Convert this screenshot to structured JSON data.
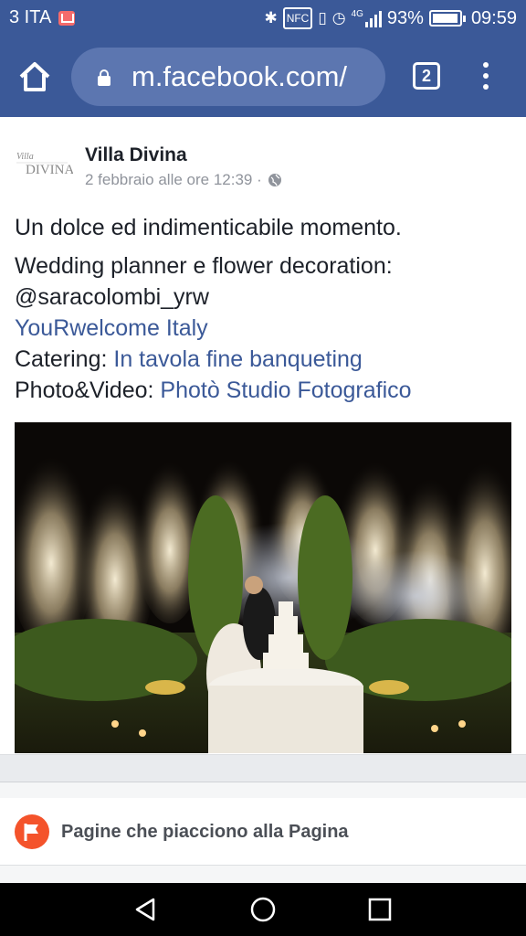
{
  "status_bar": {
    "carrier": "3 ITA",
    "battery_pct": "93%",
    "time": "09:59",
    "network": "4G",
    "battery_level": 0.93,
    "icons": [
      "mail-icon",
      "bluetooth-icon",
      "nfc-icon",
      "vibrate-icon",
      "alarm-icon",
      "signal-icon",
      "battery-icon"
    ]
  },
  "browser": {
    "url": "m.facebook.com/",
    "tab_count": "2",
    "icons": [
      "home-icon",
      "lock-icon",
      "menu-icon"
    ]
  },
  "post": {
    "page_name": "Villa Divina",
    "avatar_text": "Villa Divina",
    "timestamp": "2 febbraio alle ore 12:39 ·",
    "line1": "Un dolce ed indimenticabile momento.",
    "line2": "Wedding planner e flower decoration:",
    "line3": "@saracolombi_yrw",
    "link1": "YouRwelcome Italy",
    "catering_label": "Catering: ",
    "link2": "In tavola fine banqueting",
    "photo_label": "Photo&Video: ",
    "link3": "Photò Studio Fotografico",
    "link_color": "#3b5998"
  },
  "liked_pages": {
    "label": "Pagine che piacciono alla Pagina",
    "icon": "flag-icon",
    "icon_color": "#f4532b"
  },
  "android_nav": {
    "icons": [
      "back-icon",
      "home-circle-icon",
      "recents-icon"
    ]
  },
  "colors": {
    "facebook_blue": "#3b5998"
  }
}
